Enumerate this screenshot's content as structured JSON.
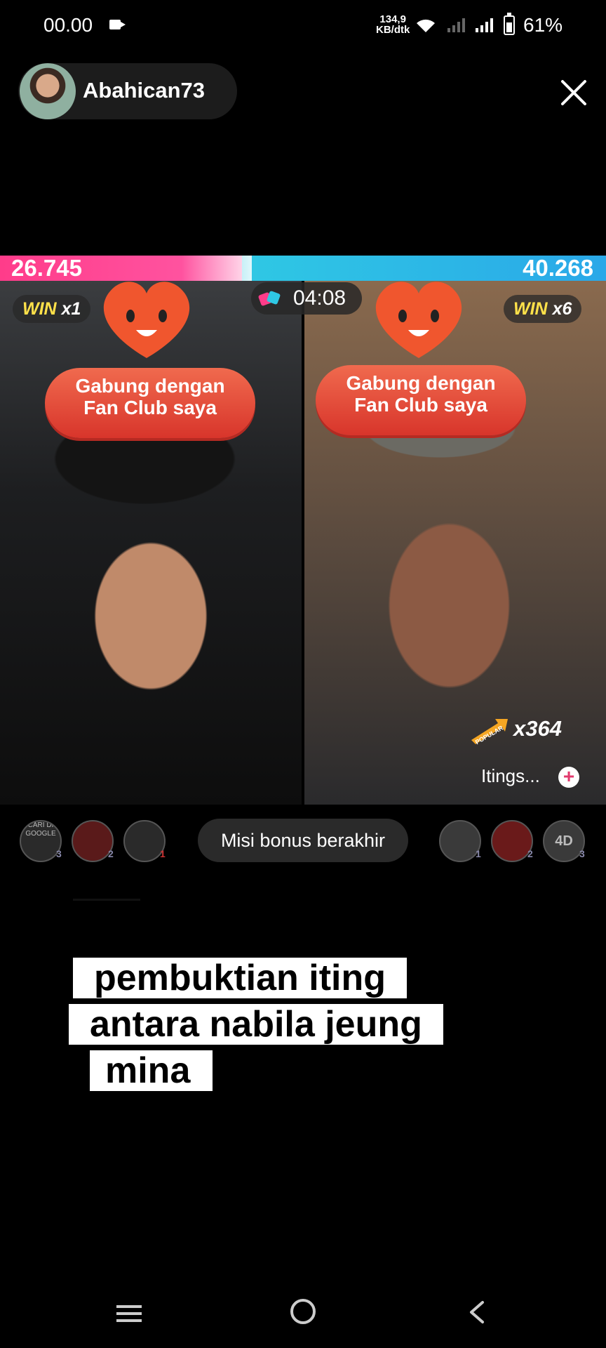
{
  "status_bar": {
    "time": "00.00",
    "net_speed_value": "134,9",
    "net_speed_unit": "KB/dtk",
    "battery": "61%"
  },
  "host": {
    "name": "Abahican73"
  },
  "battle": {
    "score_left": "26.745",
    "score_right": "40.268",
    "timer": "04:08",
    "left_win_label": "WIN",
    "left_win_count": "x1",
    "right_win_label": "WIN",
    "right_win_count": "x6",
    "left_share": 0.399
  },
  "fan_club": {
    "line1": "Gabung dengan",
    "line2": "Fan Club saya"
  },
  "popular": {
    "icon": "POPULAR",
    "count": "x364"
  },
  "itings": {
    "label": "Itings...",
    "plus": "+"
  },
  "gifters_left": [
    {
      "text": "CARI DI GOOGLE",
      "rank": "3"
    },
    {
      "text": "",
      "rank": "2"
    },
    {
      "text": "",
      "rank": "1"
    }
  ],
  "gifters_right": [
    {
      "text": "",
      "rank": "1"
    },
    {
      "text": "",
      "rank": "2"
    },
    {
      "text": "4D",
      "rank": "3"
    }
  ],
  "mission": {
    "label": "Misi bonus berakhir"
  },
  "caption": {
    "line1": "pembuktian iting",
    "line2": "antara nabila jeung",
    "line3": "mina"
  }
}
